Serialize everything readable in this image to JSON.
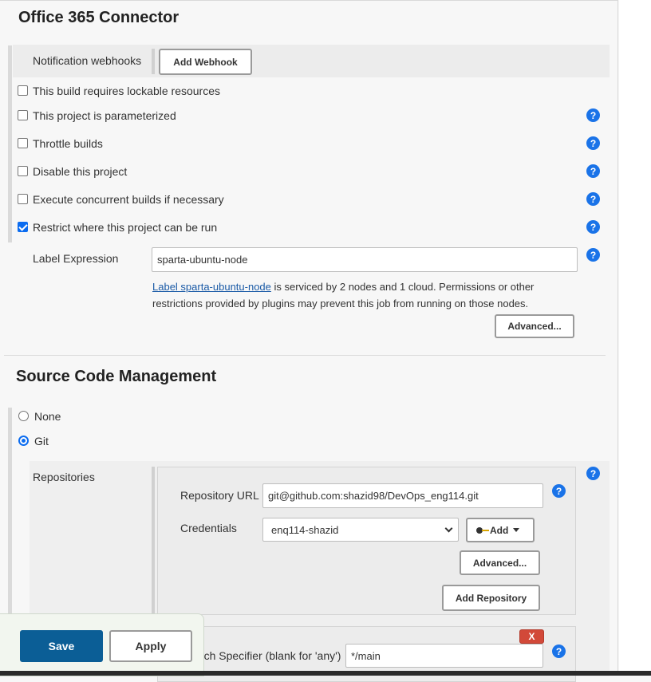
{
  "office365": {
    "title": "Office 365 Connector",
    "webhooks_label": "Notification webhooks",
    "add_webhook": "Add Webhook"
  },
  "options": [
    {
      "label": "This build requires lockable resources",
      "checked": false
    },
    {
      "label": "This project is parameterized",
      "checked": false
    },
    {
      "label": "Throttle builds",
      "checked": false
    },
    {
      "label": "Disable this project",
      "checked": false
    },
    {
      "label": "Execute concurrent builds if necessary",
      "checked": false
    },
    {
      "label": "Restrict where this project can be run",
      "checked": true
    }
  ],
  "label_expression": {
    "label": "Label Expression",
    "value": "sparta-ubuntu-node",
    "link_text": "Label sparta-ubuntu-node",
    "info_line1": " is serviced by 2 nodes and 1 cloud. Permissions or other",
    "info_line2": "restrictions provided by plugins may prevent this job from running on those nodes.",
    "advanced": "Advanced..."
  },
  "scm": {
    "title": "Source Code Management",
    "none_label": "None",
    "git_label": "Git",
    "selected": "Git",
    "repositories_label": "Repositories",
    "repo_url_label": "Repository URL",
    "repo_url_value": "git@github.com:shazid98/DevOps_eng114.git",
    "credentials_label": "Credentials",
    "credentials_value": "enq114-shazid",
    "add_label": "Add",
    "advanced": "Advanced...",
    "add_repository": "Add Repository",
    "branch_label": "Branch Specifier (blank for 'any')",
    "branch_value": "*/main",
    "delete_label": "X"
  },
  "footer": {
    "save": "Save",
    "apply": "Apply"
  },
  "help_symbol": "?",
  "colors": {
    "accent": "#1a73e8",
    "save_button": "#0b5e96",
    "delete_button": "#d24939"
  }
}
